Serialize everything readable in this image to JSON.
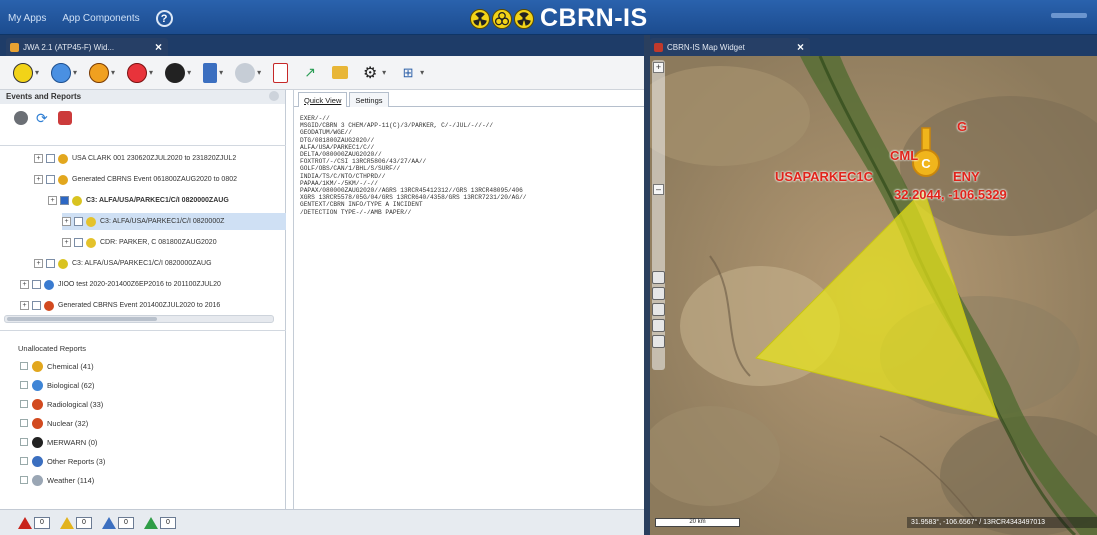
{
  "topbar": {
    "nav": [
      "My Apps",
      "App Components"
    ],
    "brand_title": "CBRN-IS"
  },
  "tabs": {
    "left_tab": "JWA 2.1 (ATP45-F) Wid...",
    "map_tab": "CBRN-IS Map Widget"
  },
  "events_panel": {
    "title": "Events and Reports",
    "tree": [
      {
        "text": "USA CLARK 001 230620ZJUL2020 to 231820ZJUL2",
        "indent": 48,
        "icon": "#e2a71e"
      },
      {
        "text": "Generated CBRNS Event 061800ZAUG2020 to 0802",
        "indent": 48,
        "icon": "#e2a71e"
      },
      {
        "text": "C3: ALFA/USA/PARKEC1/C/I 0820000ZAUG",
        "indent": 62,
        "icon": "#d9c320",
        "bold": true,
        "checked": true
      },
      {
        "text": "C3: ALFA/USA/PARKEC1/C/I 0820000Z",
        "indent": 76,
        "icon": "#e4c22b",
        "selected": true
      },
      {
        "text": "CDR: PARKER, C 081800ZAUG2020",
        "indent": 76,
        "icon": "#e4c22b"
      },
      {
        "text": "C3: ALFA/USA/PARKEC1/C/I 0820000ZAUG",
        "indent": 48,
        "icon": "#d9c320"
      },
      {
        "text": "JIOO test 2020-201400Z6EP2016 to 201100ZJUL20",
        "indent": 34,
        "icon": "#3a7bd0"
      },
      {
        "text": "Generated CBRNS Event 201400ZJUL2020 to 2016",
        "indent": 34,
        "icon": "#d24a1f"
      }
    ]
  },
  "unallocated": {
    "title": "Unallocated Reports",
    "items": [
      {
        "label": "Chemical (41)",
        "color": "#e2a71e"
      },
      {
        "label": "Biological (62)",
        "color": "#3f85d6"
      },
      {
        "label": "Radiological (33)",
        "color": "#d24a1f"
      },
      {
        "label": "Nuclear (32)",
        "color": "#d24a1f"
      },
      {
        "label": "MERWARN (0)",
        "color": "#222222"
      },
      {
        "label": "Other Reports (3)",
        "color": "#3b6fc0"
      },
      {
        "label": "Weather (114)",
        "color": "#9aa6b4"
      }
    ]
  },
  "status_counts": [
    "0",
    "0",
    "0",
    "0"
  ],
  "center_panel": {
    "tabs": [
      "Quick View",
      "Settings"
    ],
    "message": "EXER/-//\nMSGID/CBRN 3 CHEM/APP-11(C)/3/PARKER, C/-/JUL/-//-//\nGEODATUM/WGE//\nDTG/081800ZAUG2020//\nALFA/USA/PARKEC1/C//\nDELTA/080000ZAUG2020//\nFOXTROT/-/CSI 13RCR5806/43/27/AA//\nGOLF/OBS/CAN/1/BHL/S/SURF//\nINDIA/TS/C/NTO/CTHPRD//\nPAPAA/1KM/-/5KM/-/-//\nPAPAX/080000ZAUG2020//AGRS 13RCR45412312//GRS 13RCR48095/406\nXGRS 13RCR5578/05G/04/GRS 13RCR640/4358/GRS 13RCR7231/20/AG//\nGENTEXT/CBRN INFO/TYPE A INCIDENT\n/DETECTION TYPE-/-/AMB PAPER//"
  },
  "map": {
    "marker_top_label": "G",
    "label_cml": "CML",
    "label_unit": "USAPARKEC1C",
    "label_eny": "ENY",
    "label_coords": "32.2044, -106.5329",
    "scale": "20 km",
    "coordinates_readout": "31.9583°, -106.6567° / 13RCR4343497013",
    "hazard_color": "#e8e51c",
    "label_color": "#e0241b"
  }
}
